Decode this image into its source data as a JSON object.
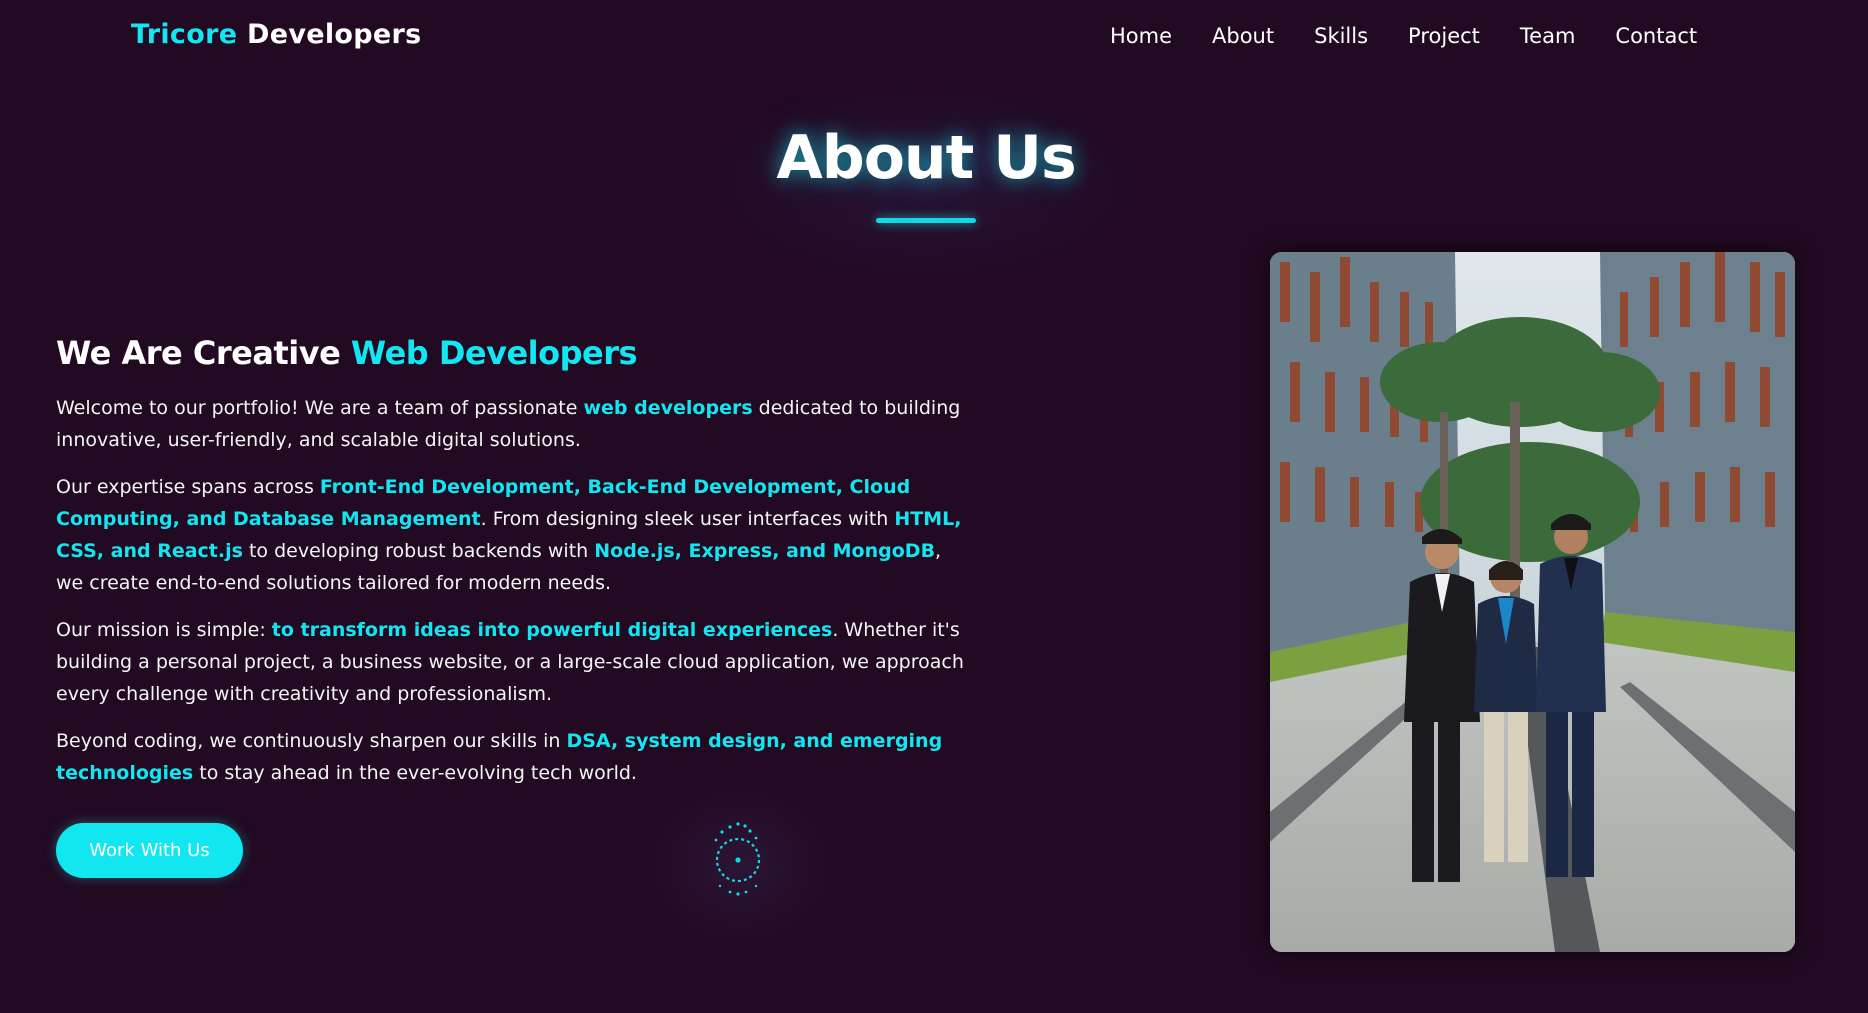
{
  "brand": {
    "accent": "Tricore",
    "rest": " Developers"
  },
  "nav": {
    "items": [
      "Home",
      "About",
      "Skills",
      "Project",
      "Team",
      "Contact"
    ]
  },
  "about": {
    "title": "About Us",
    "heading_main": "We Are Creative ",
    "heading_accent": "Web Developers",
    "p1": [
      {
        "t": "Welcome to our portfolio! We are a team of passionate "
      },
      {
        "t": "web developers",
        "hl": true
      },
      {
        "t": " dedicated to building innovative, user-friendly, and scalable digital solutions."
      }
    ],
    "p2": [
      {
        "t": "Our expertise spans across "
      },
      {
        "t": "Front-End Development, Back-End Development, Cloud Computing, and Database Management",
        "hl": true
      },
      {
        "t": ". From designing sleek user interfaces with "
      },
      {
        "t": "HTML, CSS, and React.js",
        "hl": true
      },
      {
        "t": " to developing robust backends with "
      },
      {
        "t": "Node.js, Express, and MongoDB",
        "hl": true
      },
      {
        "t": ", we create end-to-end solutions tailored for modern needs."
      }
    ],
    "p3": [
      {
        "t": "Our mission is simple: "
      },
      {
        "t": "to transform ideas into powerful digital experiences",
        "hl": true
      },
      {
        "t": ". Whether it's building a personal project, a business website, or a large-scale cloud application, we approach every challenge with creativity and professionalism."
      }
    ],
    "p4": [
      {
        "t": "Beyond coding, we continuously sharpen our skills in "
      },
      {
        "t": "DSA, system design, and emerging technologies",
        "hl": true
      },
      {
        "t": " to stay ahead in the ever-evolving tech world."
      }
    ],
    "cta_label": "Work With Us"
  },
  "colors": {
    "background": "#220a22",
    "accent": "#12e6f0",
    "text": "#ffffff"
  },
  "icons": {
    "spinner": "loading-spinner-icon",
    "photo": "team-photo"
  }
}
